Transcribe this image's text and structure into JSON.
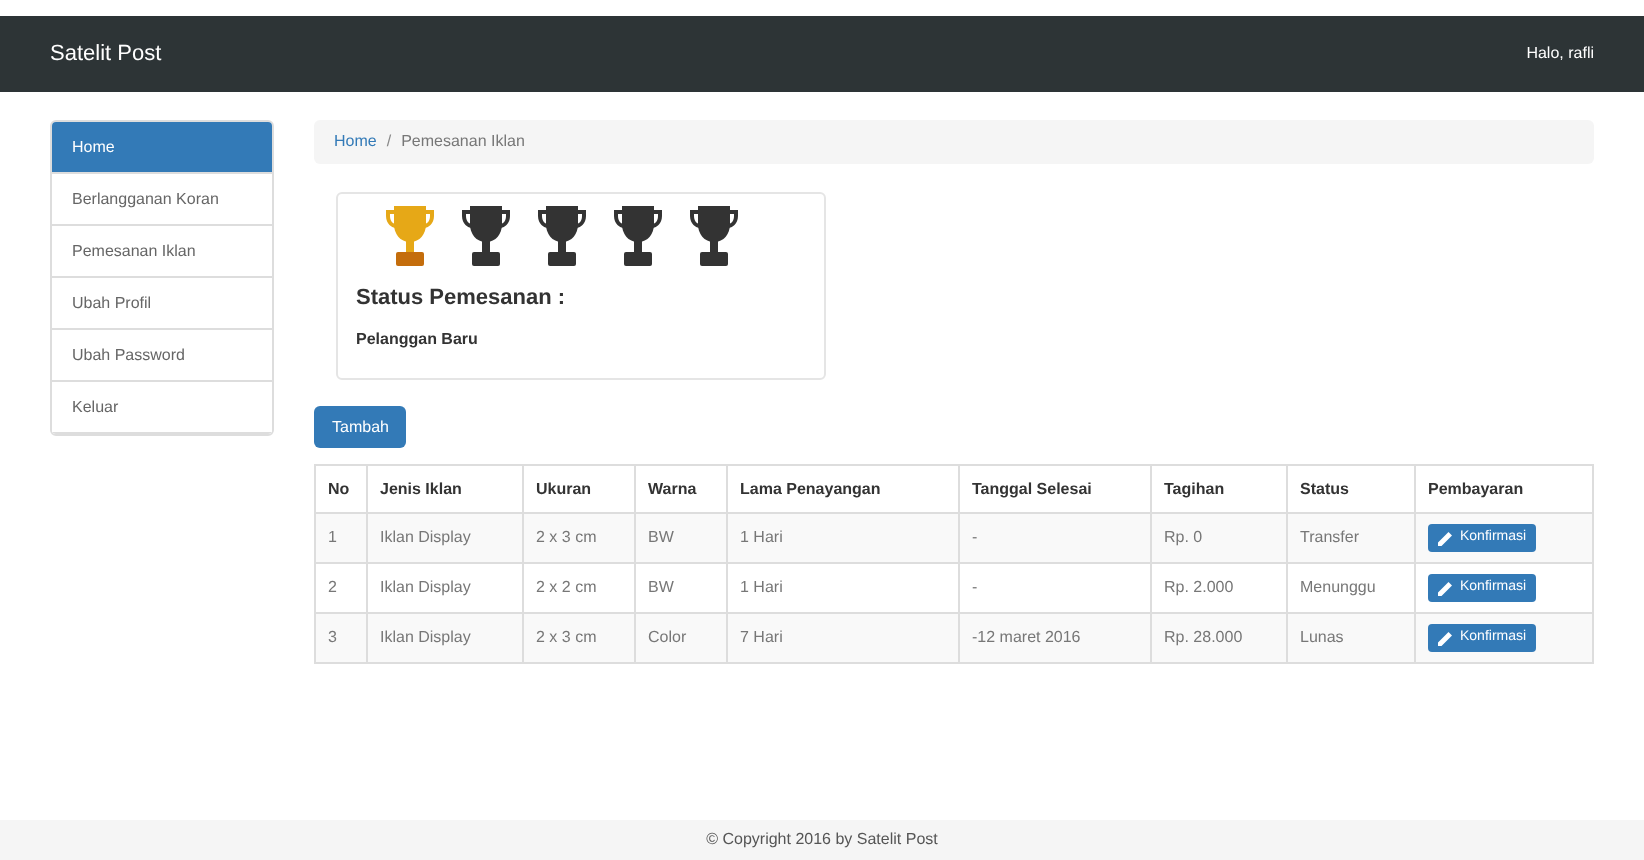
{
  "navbar": {
    "brand": "Satelit Post",
    "greeting": "Halo, rafli"
  },
  "sidebar": {
    "items": [
      {
        "label": "Home",
        "selected": true
      },
      {
        "label": "Berlangganan Koran",
        "selected": false
      },
      {
        "label": "Pemesanan Iklan",
        "selected": false
      },
      {
        "label": "Ubah Profil",
        "selected": false
      },
      {
        "label": "Ubah Password",
        "selected": false
      },
      {
        "label": "Keluar",
        "selected": false
      }
    ]
  },
  "breadcrumb": {
    "items": [
      "Home",
      "Pemesanan Iklan"
    ],
    "separator": "/"
  },
  "status_card": {
    "stars": 1,
    "title": "Status Pemesanan :",
    "value": "Pelanggan Baru"
  },
  "add_button": "Tambah",
  "table": {
    "columns": [
      "No",
      "Jenis Iklan",
      "Ukuran",
      "Warna",
      "Lama Penayangan",
      "Tanggal Selesai",
      "Tagihan",
      "Status",
      "Pembayaran"
    ],
    "rows": [
      {
        "cells": [
          "1",
          "Iklan Display",
          "2 x 3 cm",
          "BW",
          "1 Hari",
          "-",
          "Rp. 0",
          "Transfer"
        ],
        "action": "Konfirmasi"
      },
      {
        "cells": [
          "2",
          "Iklan Display",
          "2 x 2 cm",
          "BW",
          "1 Hari",
          "-",
          "Rp. 2.000",
          "Menunggu"
        ],
        "action": "Konfirmasi"
      },
      {
        "cells": [
          "3",
          "Iklan Display",
          "2 x 3 cm",
          "Color",
          "7 Hari",
          "-12 maret 2016",
          "Rp. 28.000",
          "Lunas"
        ],
        "action": "Konfirmasi"
      }
    ]
  },
  "footer": "© Copyright 2016 by Satelit Post"
}
